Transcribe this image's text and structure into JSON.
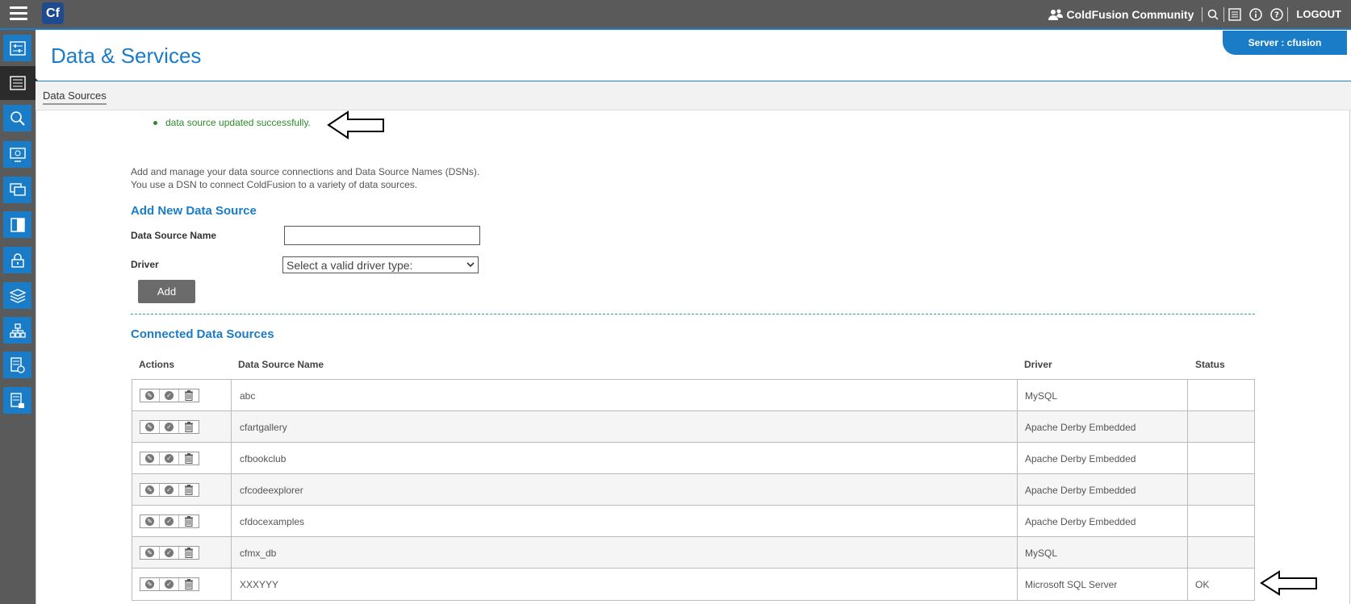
{
  "topbar": {
    "logo": "Cf",
    "community": "ColdFusion Community",
    "logout": "LOGOUT"
  },
  "header": {
    "title": "Data & Services",
    "server": "Server : cfusion"
  },
  "subnav": {
    "tab": "Data Sources"
  },
  "message": "data source updated successfully.",
  "description": {
    "line1": "Add and manage your data source connections and Data Source Names (DSNs).",
    "line2": "You use a DSN to connect ColdFusion to a variety of data sources."
  },
  "add_section": {
    "title": "Add New Data Source",
    "name_label": "Data Source Name",
    "name_value": "",
    "driver_label": "Driver",
    "driver_selected": "Select a valid driver type:",
    "add_button": "Add"
  },
  "connected": {
    "title": "Connected Data Sources",
    "columns": [
      "Actions",
      "Data Source Name",
      "Driver",
      "Status"
    ],
    "rows": [
      {
        "name": "abc",
        "driver": "MySQL",
        "status": ""
      },
      {
        "name": "cfartgallery",
        "driver": "Apache Derby Embedded",
        "status": ""
      },
      {
        "name": "cfbookclub",
        "driver": "Apache Derby Embedded",
        "status": ""
      },
      {
        "name": "cfcodeexplorer",
        "driver": "Apache Derby Embedded",
        "status": ""
      },
      {
        "name": "cfdocexamples",
        "driver": "Apache Derby Embedded",
        "status": ""
      },
      {
        "name": "cfmx_db",
        "driver": "MySQL",
        "status": ""
      },
      {
        "name": "XXXYYY",
        "driver": "Microsoft SQL Server",
        "status": "OK"
      }
    ]
  },
  "colors": {
    "accent": "#1a7cc7",
    "topbar": "#5a5a5a",
    "success": "#2e8a2e"
  }
}
